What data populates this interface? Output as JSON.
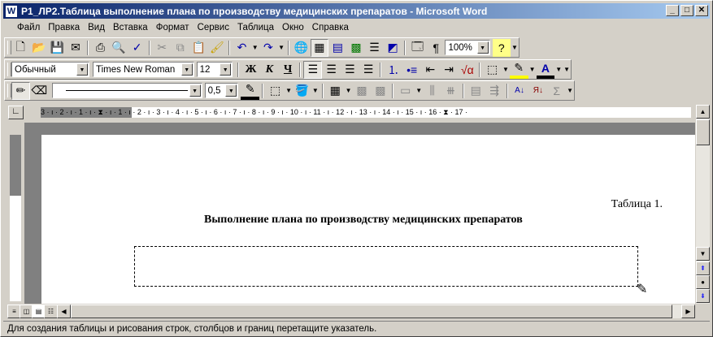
{
  "window": {
    "title": "P1_ЛР2.Таблица выполнение плана по производству медицинских препаратов - Microsoft Word",
    "app_icon": "W"
  },
  "window_controls": {
    "minimize": "_",
    "maximize": "□",
    "close": "✕"
  },
  "menu": [
    "Файл",
    "Правка",
    "Вид",
    "Вставка",
    "Формат",
    "Сервис",
    "Таблица",
    "Окно",
    "Справка"
  ],
  "standard_toolbar": {
    "zoom": "100%"
  },
  "formatting_toolbar": {
    "style": "Обычный",
    "font": "Times New Roman",
    "size": "12",
    "bold": "Ж",
    "italic": "К",
    "underline": "Ч"
  },
  "tables_toolbar": {
    "line_weight": "0,5"
  },
  "ruler": {
    "labels": "3 · ı · 2 · ı · 1 · ı · ⧗ · ı · 1 · ı · 2 · ı · 3 · ı · 4 · ı · 5 · ı · 6 · ı · 7 · ı · 8 · ı · 9 · ı · 10 · ı · 11 · ı · 12 · ı · 13 · ı · 14 · ı · 15 · ı · 16 · ⧗ · 17 ·"
  },
  "document": {
    "table_number": "Таблица 1.",
    "table_title": "Выполнение плана по производству медицинских препаратов"
  },
  "status_bar": {
    "text": "Для создания таблицы и рисования строк, столбцов и границ перетащите указатель."
  }
}
